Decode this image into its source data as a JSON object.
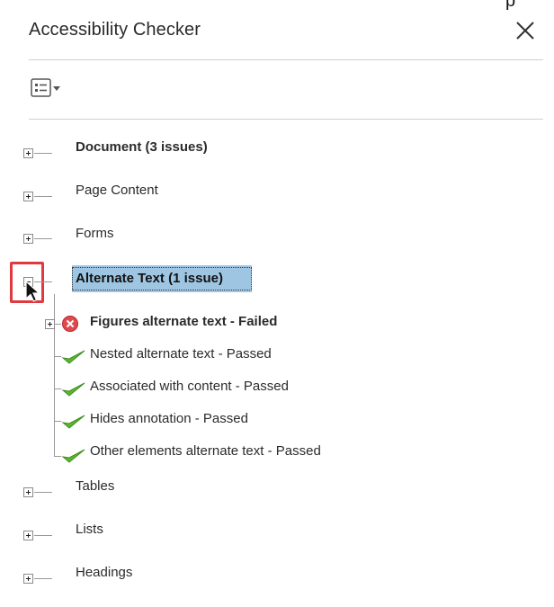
{
  "corner_text": "p",
  "panel": {
    "title": "Accessibility Checker",
    "close_icon": "close-icon",
    "options_icon": "options-menu-icon"
  },
  "tree": {
    "categories": [
      {
        "label": "Document (3 issues)",
        "bold": true,
        "expanded": false
      },
      {
        "label": "Page Content",
        "bold": false,
        "expanded": false
      },
      {
        "label": "Forms",
        "bold": false,
        "expanded": false
      },
      {
        "label": "Alternate Text (1 issue)",
        "bold": true,
        "expanded": true,
        "selected": true
      },
      {
        "label": "Tables",
        "bold": false,
        "expanded": false
      },
      {
        "label": "Lists",
        "bold": false,
        "expanded": false
      },
      {
        "label": "Headings",
        "bold": false,
        "expanded": false
      }
    ],
    "alternate_text_children": [
      {
        "label": "Figures alternate text - Failed",
        "status": "failed",
        "bold": true,
        "has_children": true
      },
      {
        "label": "Nested alternate text - Passed",
        "status": "passed",
        "bold": false
      },
      {
        "label": "Associated with content - Passed",
        "status": "passed",
        "bold": false
      },
      {
        "label": "Hides annotation - Passed",
        "status": "passed",
        "bold": false
      },
      {
        "label": "Other elements alternate text - Passed",
        "status": "passed",
        "bold": false
      }
    ]
  },
  "colors": {
    "selection": "#9ec6e3",
    "highlight_border": "#e0393e",
    "failed": "#e04a4f",
    "passed": "#5cb531"
  }
}
